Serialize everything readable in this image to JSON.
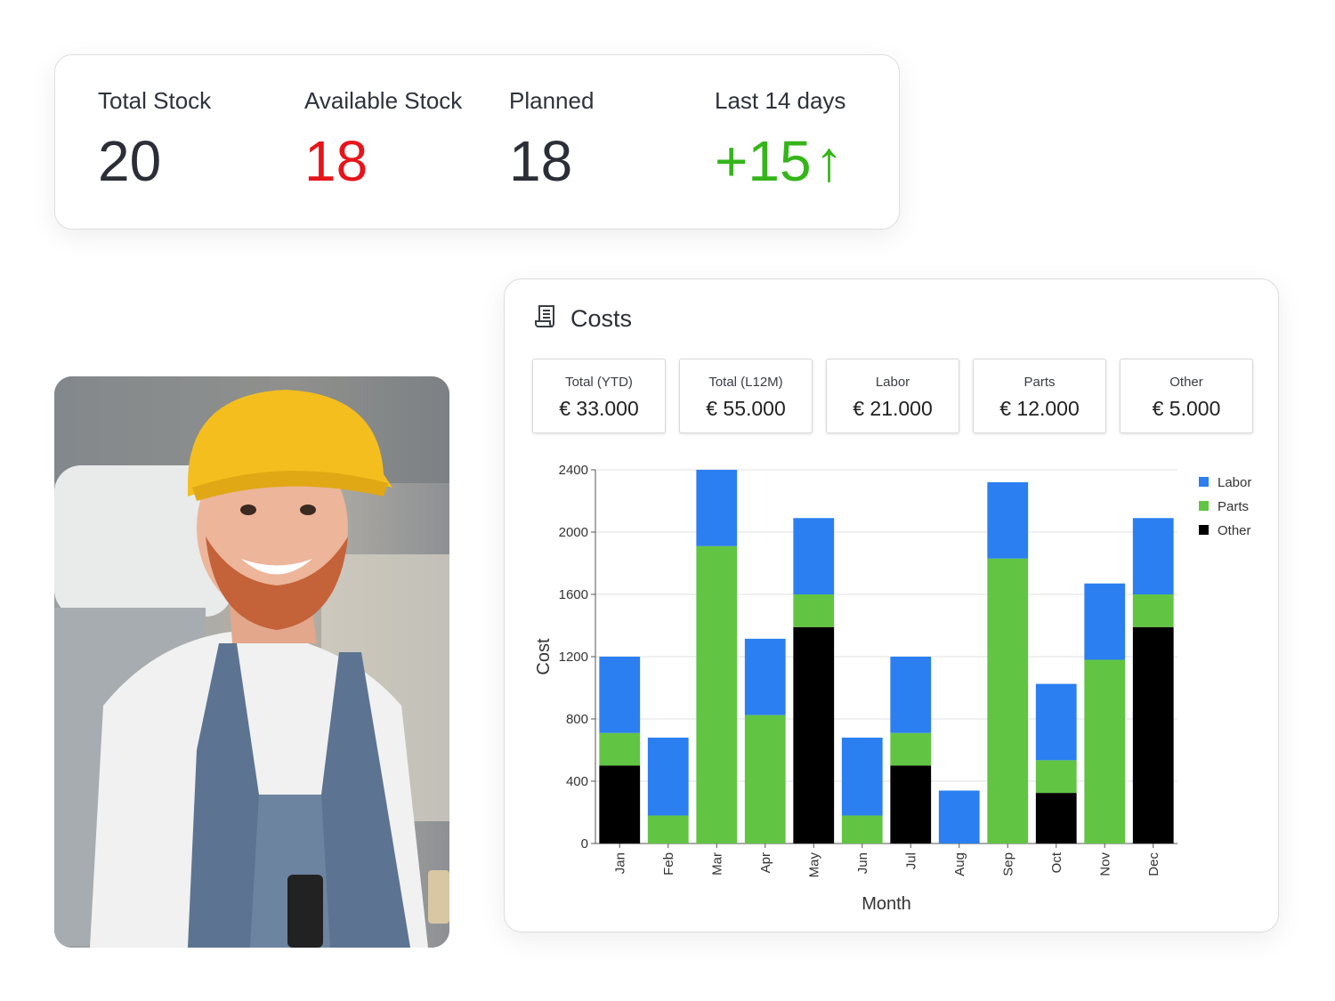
{
  "stock": {
    "total_label": "Total Stock",
    "total_value": "20",
    "available_label": "Available Stock",
    "available_value": "18",
    "planned_label": "Planned",
    "planned_value": "18",
    "last14_label": "Last 14 days",
    "last14_value": "+15",
    "last14_arrow": "↑"
  },
  "colors": {
    "labor": "#2b7ff0",
    "parts": "#62c443",
    "other": "#000000",
    "negative": "#e8141b",
    "positive": "#35b51a"
  },
  "photo": {
    "icon": "worker-photo"
  },
  "costs": {
    "title": "Costs",
    "icon": "receipt-icon",
    "kpis": [
      {
        "label": "Total (YTD)",
        "value": "€ 33.000"
      },
      {
        "label": "Total (L12M)",
        "value": "€ 55.000"
      },
      {
        "label": "Labor",
        "value": "€ 21.000"
      },
      {
        "label": "Parts",
        "value": "€ 12.000"
      },
      {
        "label": "Other",
        "value": "€ 5.000"
      }
    ]
  },
  "chart_data": {
    "type": "bar",
    "stacked": true,
    "categories": [
      "Jan",
      "Feb",
      "Mar",
      "Apr",
      "May",
      "Jun",
      "Jul",
      "Aug",
      "Sep",
      "Oct",
      "Nov",
      "Dec"
    ],
    "series": [
      {
        "name": "Other",
        "color": "#000000",
        "values": [
          500,
          0,
          0,
          0,
          1390,
          0,
          500,
          0,
          0,
          325,
          0,
          1390
        ]
      },
      {
        "name": "Parts",
        "color": "#62c443",
        "values": [
          210,
          180,
          1910,
          825,
          210,
          180,
          210,
          0,
          1830,
          210,
          1180,
          210
        ]
      },
      {
        "name": "Labor",
        "color": "#2b7ff0",
        "values": [
          490,
          500,
          490,
          490,
          490,
          500,
          490,
          340,
          490,
          490,
          490,
          490
        ]
      }
    ],
    "legend_order": [
      "Labor",
      "Parts",
      "Other"
    ],
    "legend_position": "top-right",
    "xlabel": "Month",
    "ylabel": "Cost",
    "ylim": [
      0,
      2400
    ],
    "yticks": [
      0,
      400,
      800,
      1200,
      1600,
      2000,
      2400
    ],
    "grid": true
  }
}
